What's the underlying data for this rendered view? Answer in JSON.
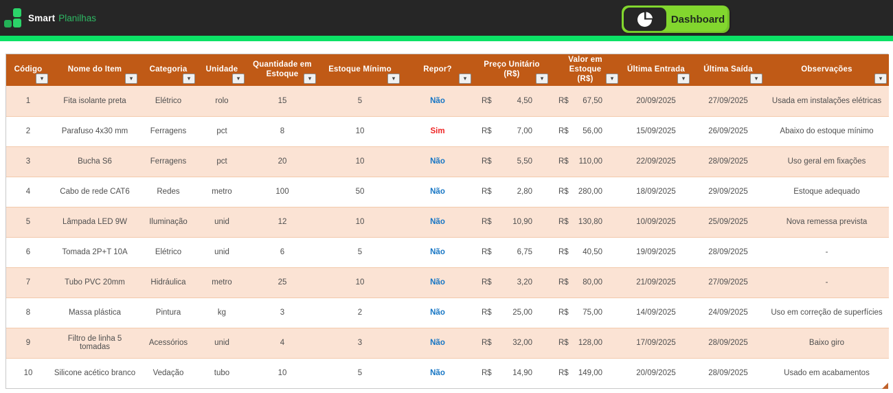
{
  "brand": {
    "name_primary": "Smart",
    "name_secondary": "Planilhas"
  },
  "nav": {
    "dashboard_label": "Dashboard"
  },
  "colors": {
    "accent_green": "#0CE166",
    "button_green": "#82D62E",
    "header_orange": "#C05A16",
    "band_peach": "#FBE3D4",
    "repor_no_blue": "#1776C4",
    "repor_yes_red": "#EE2424"
  },
  "table": {
    "currency": "R$",
    "columns": [
      {
        "key": "codigo",
        "label": "Código"
      },
      {
        "key": "nome",
        "label": "Nome do Item"
      },
      {
        "key": "categoria",
        "label": "Categoria"
      },
      {
        "key": "unidade",
        "label": "Unidade"
      },
      {
        "key": "qtd",
        "label": "Quantidade em",
        "label_line2": "Estoque"
      },
      {
        "key": "minimo",
        "label": "Estoque Mínimo"
      },
      {
        "key": "repor",
        "label": "Repor?"
      },
      {
        "key": "preco",
        "label": "Preço Unitário",
        "label_line2": "(R$)"
      },
      {
        "key": "valor",
        "label": "Valor em Estoque",
        "label_line2": "(R$)"
      },
      {
        "key": "entrada",
        "label": "Última Entrada"
      },
      {
        "key": "saida",
        "label": "Última Saída"
      },
      {
        "key": "obs",
        "label": "Observações"
      }
    ],
    "rows": [
      {
        "codigo": "1",
        "nome": "Fita isolante preta",
        "categoria": "Elétrico",
        "unidade": "rolo",
        "qtd": "15",
        "minimo": "5",
        "repor": "Não",
        "preco": "4,50",
        "valor": "67,50",
        "entrada": "20/09/2025",
        "saida": "27/09/2025",
        "obs": "Usada em instalações elétricas"
      },
      {
        "codigo": "2",
        "nome": "Parafuso 4x30 mm",
        "categoria": "Ferragens",
        "unidade": "pct",
        "qtd": "8",
        "minimo": "10",
        "repor": "Sim",
        "preco": "7,00",
        "valor": "56,00",
        "entrada": "15/09/2025",
        "saida": "26/09/2025",
        "obs": "Abaixo do estoque mínimo"
      },
      {
        "codigo": "3",
        "nome": "Bucha S6",
        "categoria": "Ferragens",
        "unidade": "pct",
        "qtd": "20",
        "minimo": "10",
        "repor": "Não",
        "preco": "5,50",
        "valor": "110,00",
        "entrada": "22/09/2025",
        "saida": "28/09/2025",
        "obs": "Uso geral em fixações"
      },
      {
        "codigo": "4",
        "nome": "Cabo de rede CAT6",
        "categoria": "Redes",
        "unidade": "metro",
        "qtd": "100",
        "minimo": "50",
        "repor": "Não",
        "preco": "2,80",
        "valor": "280,00",
        "entrada": "18/09/2025",
        "saida": "29/09/2025",
        "obs": "Estoque adequado"
      },
      {
        "codigo": "5",
        "nome": "Lâmpada LED 9W",
        "categoria": "Iluminação",
        "unidade": "unid",
        "qtd": "12",
        "minimo": "10",
        "repor": "Não",
        "preco": "10,90",
        "valor": "130,80",
        "entrada": "10/09/2025",
        "saida": "25/09/2025",
        "obs": "Nova remessa prevista"
      },
      {
        "codigo": "6",
        "nome": "Tomada 2P+T 10A",
        "categoria": "Elétrico",
        "unidade": "unid",
        "qtd": "6",
        "minimo": "5",
        "repor": "Não",
        "preco": "6,75",
        "valor": "40,50",
        "entrada": "19/09/2025",
        "saida": "28/09/2025",
        "obs": "-"
      },
      {
        "codigo": "7",
        "nome": "Tubo PVC 20mm",
        "categoria": "Hidráulica",
        "unidade": "metro",
        "qtd": "25",
        "minimo": "10",
        "repor": "Não",
        "preco": "3,20",
        "valor": "80,00",
        "entrada": "21/09/2025",
        "saida": "27/09/2025",
        "obs": "-"
      },
      {
        "codigo": "8",
        "nome": "Massa plástica",
        "categoria": "Pintura",
        "unidade": "kg",
        "qtd": "3",
        "minimo": "2",
        "repor": "Não",
        "preco": "25,00",
        "valor": "75,00",
        "entrada": "14/09/2025",
        "saida": "24/09/2025",
        "obs": "Uso em correção de superfícies"
      },
      {
        "codigo": "9",
        "nome": "Filtro de linha 5 tomadas",
        "categoria": "Acessórios",
        "unidade": "unid",
        "qtd": "4",
        "minimo": "3",
        "repor": "Não",
        "preco": "32,00",
        "valor": "128,00",
        "entrada": "17/09/2025",
        "saida": "28/09/2025",
        "obs": "Baixo giro"
      },
      {
        "codigo": "10",
        "nome": "Silicone acético branco",
        "categoria": "Vedação",
        "unidade": "tubo",
        "qtd": "10",
        "minimo": "5",
        "repor": "Não",
        "preco": "14,90",
        "valor": "149,00",
        "entrada": "20/09/2025",
        "saida": "28/09/2025",
        "obs": "Usado em acabamentos"
      }
    ]
  }
}
